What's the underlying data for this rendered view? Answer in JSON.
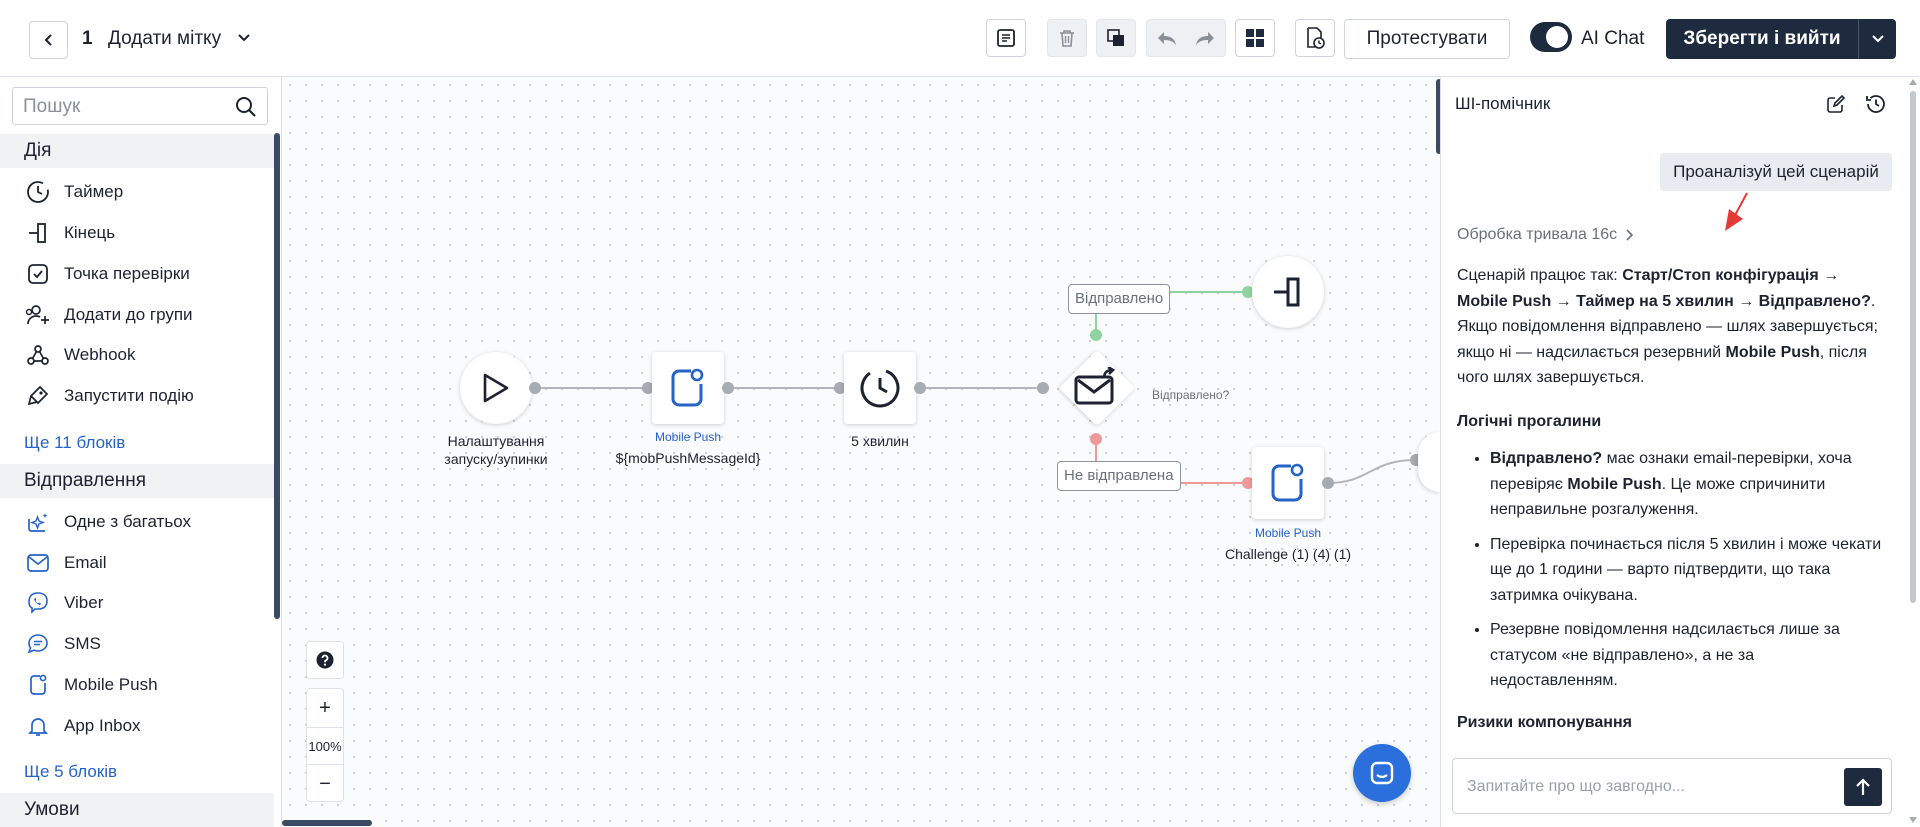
{
  "header": {
    "step_number": "1",
    "step_name": "Додати мітку",
    "test_label": "Протестувати",
    "ai_chat_label": "AI Chat",
    "save_label": "Зберегти і вийти"
  },
  "sidebar": {
    "search_placeholder": "Пошук",
    "actions_title": "Дія",
    "actions": [
      {
        "label": "Таймер",
        "icon": "timer-icon"
      },
      {
        "label": "Кінець",
        "icon": "end-icon"
      },
      {
        "label": "Точка перевірки",
        "icon": "checkpoint-icon"
      },
      {
        "label": "Додати до групи",
        "icon": "add-to-group-icon"
      },
      {
        "label": "Webhook",
        "icon": "webhook-icon"
      },
      {
        "label": "Запустити подію",
        "icon": "trigger-event-icon"
      }
    ],
    "actions_more": "Ще 11 блоків",
    "sending_title": "Відправлення",
    "sending": [
      {
        "label": "Одне з багатьох",
        "icon": "sparkle-icon"
      },
      {
        "label": "Email",
        "icon": "email-icon"
      },
      {
        "label": "Viber",
        "icon": "viber-icon"
      },
      {
        "label": "SMS",
        "icon": "sms-icon"
      },
      {
        "label": "Mobile Push",
        "icon": "mobile-push-icon"
      },
      {
        "label": "App Inbox",
        "icon": "bell-icon"
      }
    ],
    "sending_more": "Ще 5 блоків",
    "conditions_title": "Умови"
  },
  "canvas": {
    "zoom": "100%",
    "nodes": {
      "start": {
        "label_line1": "Налаштування",
        "label_line2": "запуску/зупинки"
      },
      "push1": {
        "type": "Mobile Push",
        "label": "${mobPushMessageId}"
      },
      "timer": {
        "label": "5 хвилин"
      },
      "check": {
        "label": "Відправлено?"
      },
      "push2": {
        "type": "Mobile Push",
        "label": "Challenge (1) (4) (1)"
      }
    },
    "edges": {
      "sent": "Відправлено",
      "not_sent": "Не відправлена"
    }
  },
  "ai_panel": {
    "title": "ШІ-помічник",
    "user_message": "Проаналізуй цей сценарій",
    "processing": "Обробка тривала 16с",
    "intro": {
      "t1": "Сценарій працює так: ",
      "b1": "Старт/Стоп конфігурація → Mobile Push → Таймер на 5 хвилин → Відправлено?",
      "t2": ". Якщо повідомлення відправлено — шлях завершується; якщо ні — надсилається резервний ",
      "b2": "Mobile Push",
      "t3": ", після чого шлях завершується."
    },
    "logic_title": "Логічні прогалини",
    "bullet1": {
      "b1": "Відправлено?",
      "t1": " має ознаки email-перевірки, хоча перевіряє ",
      "b2": "Mobile Push",
      "t2": ". Це може спричинити неправильне розгалуження."
    },
    "bullet2": "Перевірка починається після 5 хвилин і може чекати ще до 1 години — варто підтвердити, що така затримка очікувана.",
    "bullet3": "Резервне повідомлення надсилається лише за статусом «не відправлено», а не за недоставленням.",
    "risks_title": "Ризики компонування",
    "input_placeholder": "Запитайте про що завгодно..."
  },
  "colors": {
    "primary": "#1e2a3e",
    "link": "#2563c8",
    "success_edge": "#8fd3a0",
    "fail_edge": "#ef9a9a",
    "annotation_arrow": "#e53935"
  }
}
